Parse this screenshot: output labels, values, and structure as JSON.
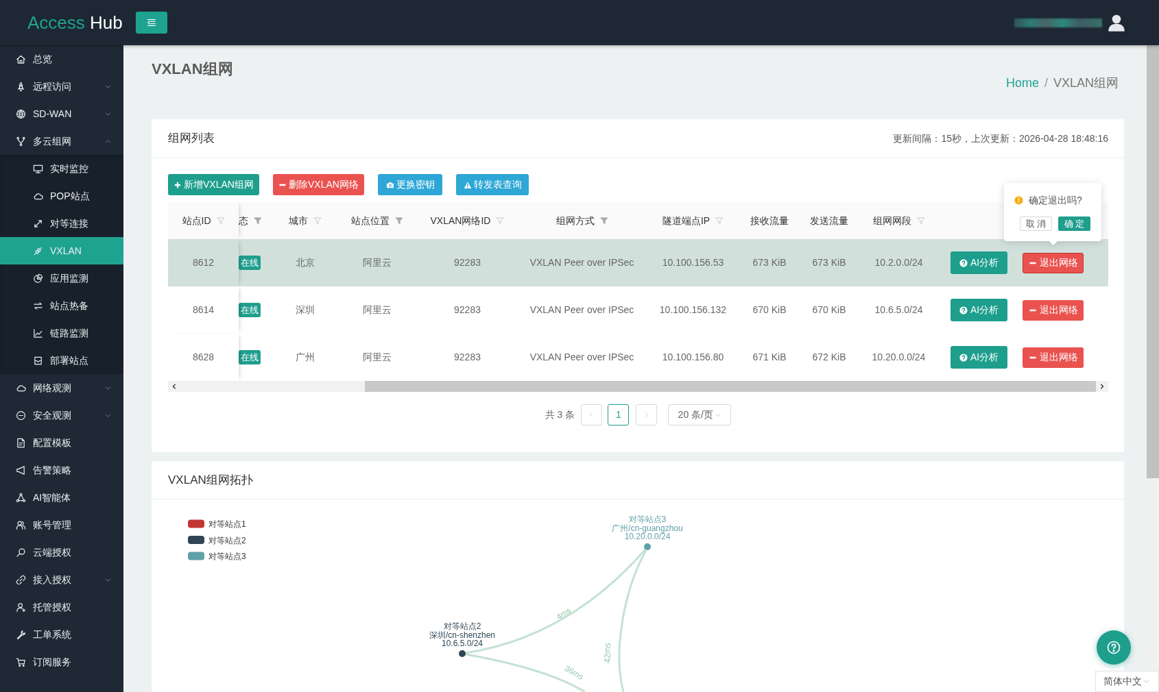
{
  "header": {
    "logo": {
      "first_word": "Access",
      "second_word": "Hub"
    }
  },
  "sidebar": {
    "items": [
      {
        "label": "总览",
        "selected": false
      },
      {
        "label": "远程访问",
        "selected": false,
        "expanded": false
      },
      {
        "label": "SD-WAN",
        "selected": false,
        "expanded": false
      },
      {
        "label": "多云组网",
        "selected": false,
        "expanded": true,
        "children": [
          {
            "label": "实时监控",
            "selected": false
          },
          {
            "label": "POP站点",
            "selected": false
          },
          {
            "label": "对等连接",
            "selected": false
          },
          {
            "label": "VXLAN",
            "selected": true
          },
          {
            "label": "应用监测",
            "selected": false
          },
          {
            "label": "站点热备",
            "selected": false
          },
          {
            "label": "链路监测",
            "selected": false
          },
          {
            "label": "部署站点",
            "selected": false
          }
        ]
      },
      {
        "label": "网络观测",
        "selected": false,
        "expanded": false
      },
      {
        "label": "安全观测",
        "selected": false,
        "expanded": false
      },
      {
        "label": "配置模板",
        "selected": false
      },
      {
        "label": "告警策略",
        "selected": false
      },
      {
        "label": "AI智能体",
        "selected": false
      },
      {
        "label": "账号管理",
        "selected": false
      },
      {
        "label": "云端授权",
        "selected": false
      },
      {
        "label": "接入授权",
        "selected": false,
        "expanded": false
      },
      {
        "label": "托管授权",
        "selected": false
      },
      {
        "label": "工单系统",
        "selected": false
      },
      {
        "label": "订阅服务",
        "selected": false
      }
    ]
  },
  "page": {
    "title": "VXLAN组网",
    "breadcrumb_separator": "/",
    "breadcrumb": [
      {
        "label": "Home",
        "current": false
      },
      {
        "label": "VXLAN组网",
        "current": true
      }
    ]
  },
  "network_list": {
    "title": "组网列表",
    "update_info": "更新间隔：15秒，上次更新：2026-04-28 18:48:16",
    "toolbar": [
      {
        "label": "新增VXLAN组网",
        "kind": "add"
      },
      {
        "label": "删除VXLAN网络",
        "kind": "delete"
      },
      {
        "label": "更换密钥",
        "kind": "key"
      },
      {
        "label": "转发表查询",
        "kind": "lookup"
      }
    ],
    "table": {
      "columns": [
        {
          "label": "站点ID",
          "kind": "text",
          "filtered": false
        },
        {
          "label": "态",
          "kind": "tag",
          "filtered": true
        },
        {
          "label": "城市",
          "kind": "text",
          "filtered": false
        },
        {
          "label": "站点位置",
          "kind": "text",
          "filtered": true
        },
        {
          "label": "VXLAN网络ID",
          "kind": "text",
          "filtered": false
        },
        {
          "label": "组网方式",
          "kind": "text",
          "filtered": true
        },
        {
          "label": "隧道端点IP",
          "kind": "text",
          "filtered": false
        },
        {
          "label": "接收流量",
          "kind": "text"
        },
        {
          "label": "发送流量",
          "kind": "text"
        },
        {
          "label": "组网网段",
          "kind": "text",
          "filtered": false
        }
      ],
      "rows": [
        {
          "highlighted": true,
          "cells": [
            "8612",
            "在线",
            "北京",
            "阿里云",
            "92283",
            "VXLAN Peer over IPSec",
            "10.100.156.53",
            "673 KiB",
            "673 KiB",
            "10.2.0.0/24"
          ],
          "actions": [
            {
              "label": "AI分析",
              "kind": "analyze",
              "active": false
            },
            {
              "label": "退出网络",
              "kind": "leave",
              "active": true
            }
          ]
        },
        {
          "highlighted": false,
          "cells": [
            "8614",
            "在线",
            "深圳",
            "阿里云",
            "92283",
            "VXLAN Peer over IPSec",
            "10.100.156.132",
            "670 KiB",
            "670 KiB",
            "10.6.5.0/24"
          ],
          "actions": [
            {
              "label": "AI分析",
              "kind": "analyze",
              "active": false
            },
            {
              "label": "退出网络",
              "kind": "leave",
              "active": false
            }
          ]
        },
        {
          "highlighted": false,
          "cells": [
            "8628",
            "在线",
            "广州",
            "阿里云",
            "92283",
            "VXLAN Peer over IPSec",
            "10.100.156.80",
            "671 KiB",
            "672 KiB",
            "10.20.0.0/24"
          ],
          "actions": [
            {
              "label": "AI分析",
              "kind": "analyze",
              "active": false
            },
            {
              "label": "退出网络",
              "kind": "leave",
              "active": false
            }
          ]
        }
      ]
    },
    "popconfirm": {
      "message": "确定退出吗?",
      "buttons": [
        {
          "label": "取 消",
          "kind": "cancel"
        },
        {
          "label": "确 定",
          "kind": "confirm"
        }
      ]
    },
    "pagination": {
      "total": "共 3 条",
      "previous_disabled": true,
      "pages": [
        {
          "label": "1",
          "selected": true
        }
      ],
      "next_disabled": true,
      "page_size": "20 条/页"
    }
  },
  "topology": {
    "title": "VXLAN组网拓扑",
    "legend": [
      {
        "label": "对等站点1",
        "color": "#c23531"
      },
      {
        "label": "对等站点2",
        "color": "#2f4554"
      },
      {
        "label": "对等站点3",
        "color": "#61a0a8"
      }
    ],
    "nodes": [
      {
        "name": "对等站点3",
        "location": "广州/cn-guangzhou",
        "subnet": "10.20.0.0/24",
        "color": "#61a0a8"
      },
      {
        "name": "对等站点2",
        "location": "深圳/cn-shenzhen",
        "subnet": "10.6.5.0/24",
        "color": "#2f4554"
      }
    ],
    "links": [
      {
        "label": "4ms"
      },
      {
        "label": "42ms"
      },
      {
        "label": "36ms"
      }
    ]
  },
  "language_select": {
    "value": "简体中文"
  }
}
